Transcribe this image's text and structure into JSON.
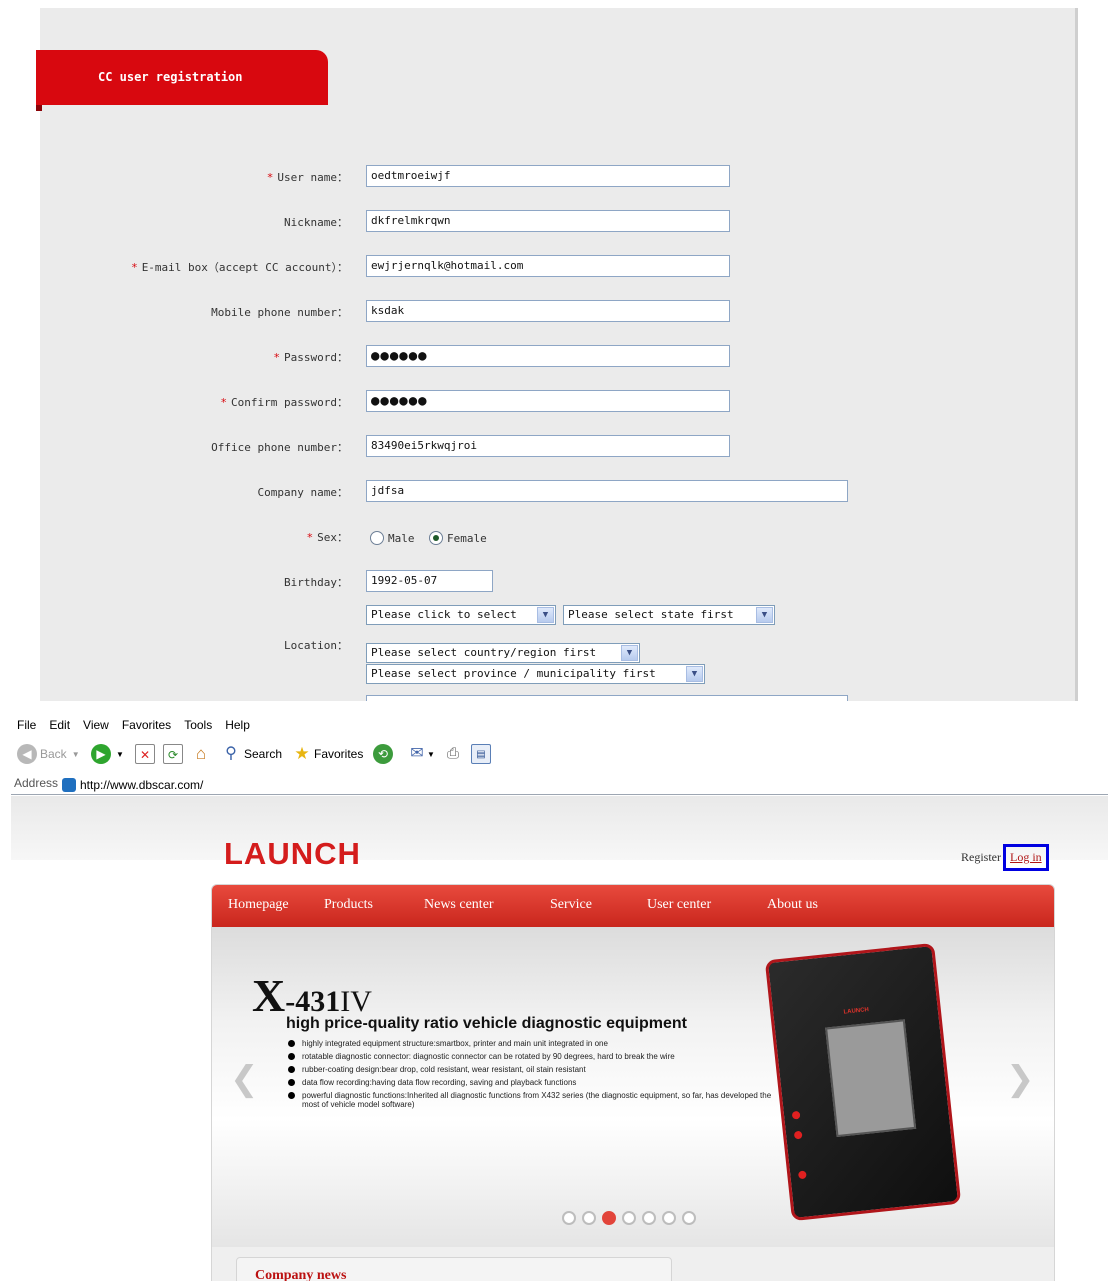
{
  "registration": {
    "tab_title": "CC user registration",
    "fields": [
      {
        "label": "User name：",
        "required": true,
        "value": "oedtmroeiwjf"
      },
      {
        "label": "Nickname：",
        "required": false,
        "value": "dkfrelmkrqwn"
      },
      {
        "label": "E-mail box（accept CC account）：",
        "required": true,
        "value": "ewjrjernqlk@hotmail.com"
      },
      {
        "label": "Mobile phone number：",
        "required": false,
        "value": "ksdak"
      },
      {
        "label": "Password：",
        "required": true,
        "value": "●●●●●●"
      },
      {
        "label": "Confirm password：",
        "required": true,
        "value": "●●●●●●"
      },
      {
        "label": "Office phone number：",
        "required": false,
        "value": "83490ei5rkwqjroi"
      },
      {
        "label": "Company name：",
        "required": false,
        "value": "jdfsa"
      }
    ],
    "sex": {
      "label": "Sex：",
      "options": [
        "Male",
        "Female"
      ],
      "selected": "Female"
    },
    "birthday": {
      "label": "Birthday：",
      "value": "1992-05-07"
    },
    "location": {
      "label": "Location：",
      "selects": [
        "Please click to select",
        "Please select state first",
        "Please select country/region first",
        "Please select province / municipality first"
      ]
    },
    "required_mark": "*"
  },
  "browser": {
    "menu": [
      "File",
      "Edit",
      "View",
      "Favorites",
      "Tools",
      "Help"
    ],
    "toolbar": {
      "back": "Back",
      "search": "Search",
      "favorites": "Favorites"
    },
    "address": {
      "label": "Address",
      "url": "http://www.dbscar.com/"
    }
  },
  "site": {
    "logo": "LAUNCH",
    "register": "Register",
    "login": "Log in",
    "nav": [
      "Homepage",
      "Products",
      "News center",
      "Service",
      "User center",
      "About us"
    ],
    "banner": {
      "product_prefix": "X",
      "product_model": "-431",
      "product_suffix": "IV",
      "headline": "high price-quality ratio vehicle diagnostic equipment",
      "features": [
        "highly integrated equipment structure:smartbox, printer and main unit integrated in one",
        "rotatable diagnostic connector: diagnostic connector can be rotated by 90 degrees, hard to break the wire",
        "rubber-coating  design:bear drop, cold resistant, wear resistant, oil stain resistant",
        "data flow recording:having data flow recording, saving and playback functions",
        "powerful diagnostic functions:Inherited all diagnostic functions from X432 series (the diagnostic equipment, so far, has developed the most of vehicle model software)"
      ],
      "device_brand": "LAUNCH",
      "dots_total": 7,
      "dot_active": 3
    },
    "news_title": "Company news"
  },
  "colors": {
    "brand_red": "#d41c1c",
    "tab_red": "#d8080f",
    "highlight_blue": "#0000e0"
  }
}
